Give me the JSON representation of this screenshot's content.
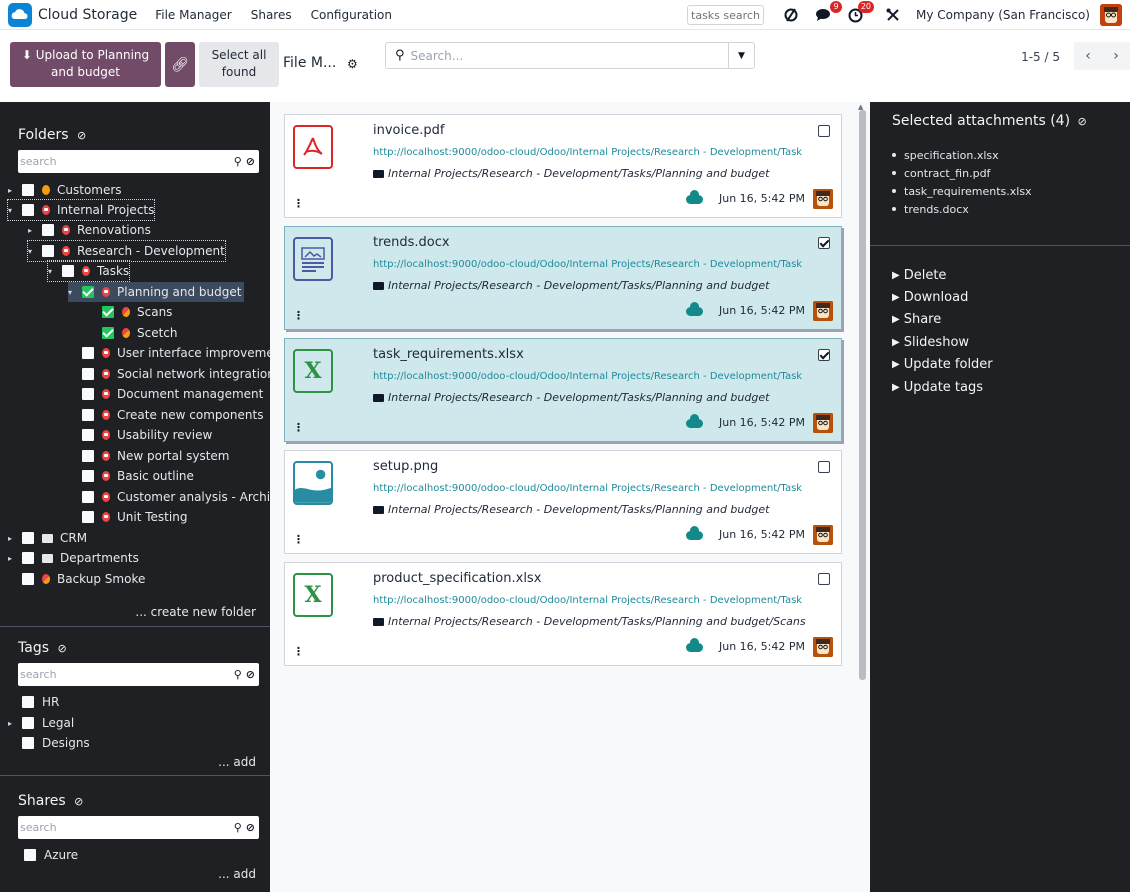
{
  "app": {
    "title": "Cloud Storage",
    "menus": [
      "File Manager",
      "Shares",
      "Configuration"
    ]
  },
  "navbar": {
    "tasks_search_placeholder": "tasks search",
    "messages_badge": "9",
    "activities_badge": "20",
    "company": "My Company (San Francisco)"
  },
  "control": {
    "upload_label": "Upload to Planning and budget",
    "select_all_label": "Select all found",
    "breadcrumb": "File M...",
    "search_placeholder": "Search...",
    "pager": "1-5 / 5",
    "prev": "‹",
    "next": "›"
  },
  "sidebar": {
    "folders_heading": "Folders",
    "folders_search_placeholder": "search",
    "folders": [
      {
        "label": "Customers",
        "icon": "orange",
        "checked": false,
        "arrow": "▸"
      },
      {
        "label": "Internal Projects",
        "icon": "red",
        "checked": false,
        "arrow": "▾"
      },
      {
        "label": "Renovations",
        "icon": "red",
        "checked": false,
        "arrow": "▸"
      },
      {
        "label": "Research - Development",
        "icon": "red",
        "checked": false,
        "arrow": "▾"
      },
      {
        "label": "Tasks",
        "icon": "red",
        "checked": false,
        "arrow": "▾"
      },
      {
        "label": "Planning and budget",
        "icon": "red",
        "checked": true,
        "arrow": "▾"
      },
      {
        "label": "Scans",
        "icon": "mix",
        "checked": true,
        "arrow": ""
      },
      {
        "label": "Scetch",
        "icon": "mix",
        "checked": true,
        "arrow": ""
      },
      {
        "label": "User interface improvement",
        "icon": "red",
        "checked": false,
        "arrow": ""
      },
      {
        "label": "Social network integration",
        "icon": "red",
        "checked": false,
        "arrow": ""
      },
      {
        "label": "Document management",
        "icon": "red",
        "checked": false,
        "arrow": ""
      },
      {
        "label": "Create new components",
        "icon": "red",
        "checked": false,
        "arrow": ""
      },
      {
        "label": "Usability review",
        "icon": "red",
        "checked": false,
        "arrow": ""
      },
      {
        "label": "New portal system",
        "icon": "red",
        "checked": false,
        "arrow": ""
      },
      {
        "label": "Basic outline",
        "icon": "red",
        "checked": false,
        "arrow": ""
      },
      {
        "label": "Customer analysis - Architecture",
        "icon": "red",
        "checked": false,
        "arrow": ""
      },
      {
        "label": "Unit Testing",
        "icon": "red",
        "checked": false,
        "arrow": ""
      },
      {
        "label": "CRM",
        "icon": "folder",
        "checked": false,
        "arrow": "▸"
      },
      {
        "label": "Departments",
        "icon": "folder",
        "checked": false,
        "arrow": "▸"
      },
      {
        "label": "Backup Smoke",
        "icon": "mix",
        "checked": false,
        "arrow": ""
      }
    ],
    "create_folder": "... create new folder",
    "tags_heading": "Tags",
    "tags_search_placeholder": "search",
    "tags": [
      {
        "label": "HR",
        "arrow": ""
      },
      {
        "label": "Legal",
        "arrow": "▸"
      },
      {
        "label": "Designs",
        "arrow": ""
      }
    ],
    "tags_add": "... add",
    "shares_heading": "Shares",
    "shares_search_placeholder": "search",
    "shares": [
      {
        "label": "Azure"
      }
    ],
    "shares_add": "... add"
  },
  "attachments": [
    {
      "name": "invoice.pdf",
      "type": "pdf",
      "url": "http://localhost:9000/odoo-cloud/Odoo/Internal Projects/Research - Development/Task",
      "path": "Internal Projects/Research - Development/Tasks/Planning and budget",
      "date": "Jun 16, 5:42 PM",
      "selected": false
    },
    {
      "name": "trends.docx",
      "type": "doc",
      "url": "http://localhost:9000/odoo-cloud/Odoo/Internal Projects/Research - Development/Task",
      "path": "Internal Projects/Research - Development/Tasks/Planning and budget",
      "date": "Jun 16, 5:42 PM",
      "selected": true
    },
    {
      "name": "task_requirements.xlsx",
      "type": "xls",
      "url": "http://localhost:9000/odoo-cloud/Odoo/Internal Projects/Research - Development/Task",
      "path": "Internal Projects/Research - Development/Tasks/Planning and budget",
      "date": "Jun 16, 5:42 PM",
      "selected": true
    },
    {
      "name": "setup.png",
      "type": "img",
      "url": "http://localhost:9000/odoo-cloud/Odoo/Internal Projects/Research - Development/Task",
      "path": "Internal Projects/Research - Development/Tasks/Planning and budget",
      "date": "Jun 16, 5:42 PM",
      "selected": false
    },
    {
      "name": "product_specification.xlsx",
      "type": "xls",
      "url": "http://localhost:9000/odoo-cloud/Odoo/Internal Projects/Research - Development/Task",
      "path": "Internal Projects/Research - Development/Tasks/Planning and budget/Scans",
      "date": "Jun 16, 5:42 PM",
      "selected": false
    }
  ],
  "inspector": {
    "title": "Selected attachments (4)",
    "files": [
      "specification.xlsx",
      "contract_fin.pdf",
      "task_requirements.xlsx",
      "trends.docx"
    ],
    "actions": [
      "Delete",
      "Download",
      "Share",
      "Slideshow",
      "Update folder",
      "Update tags"
    ]
  },
  "colors": {
    "primary": "#714B67",
    "sidebar_bg": "#1e2024",
    "selected_card": "#cfe8ec",
    "link": "#1f8a9a"
  }
}
